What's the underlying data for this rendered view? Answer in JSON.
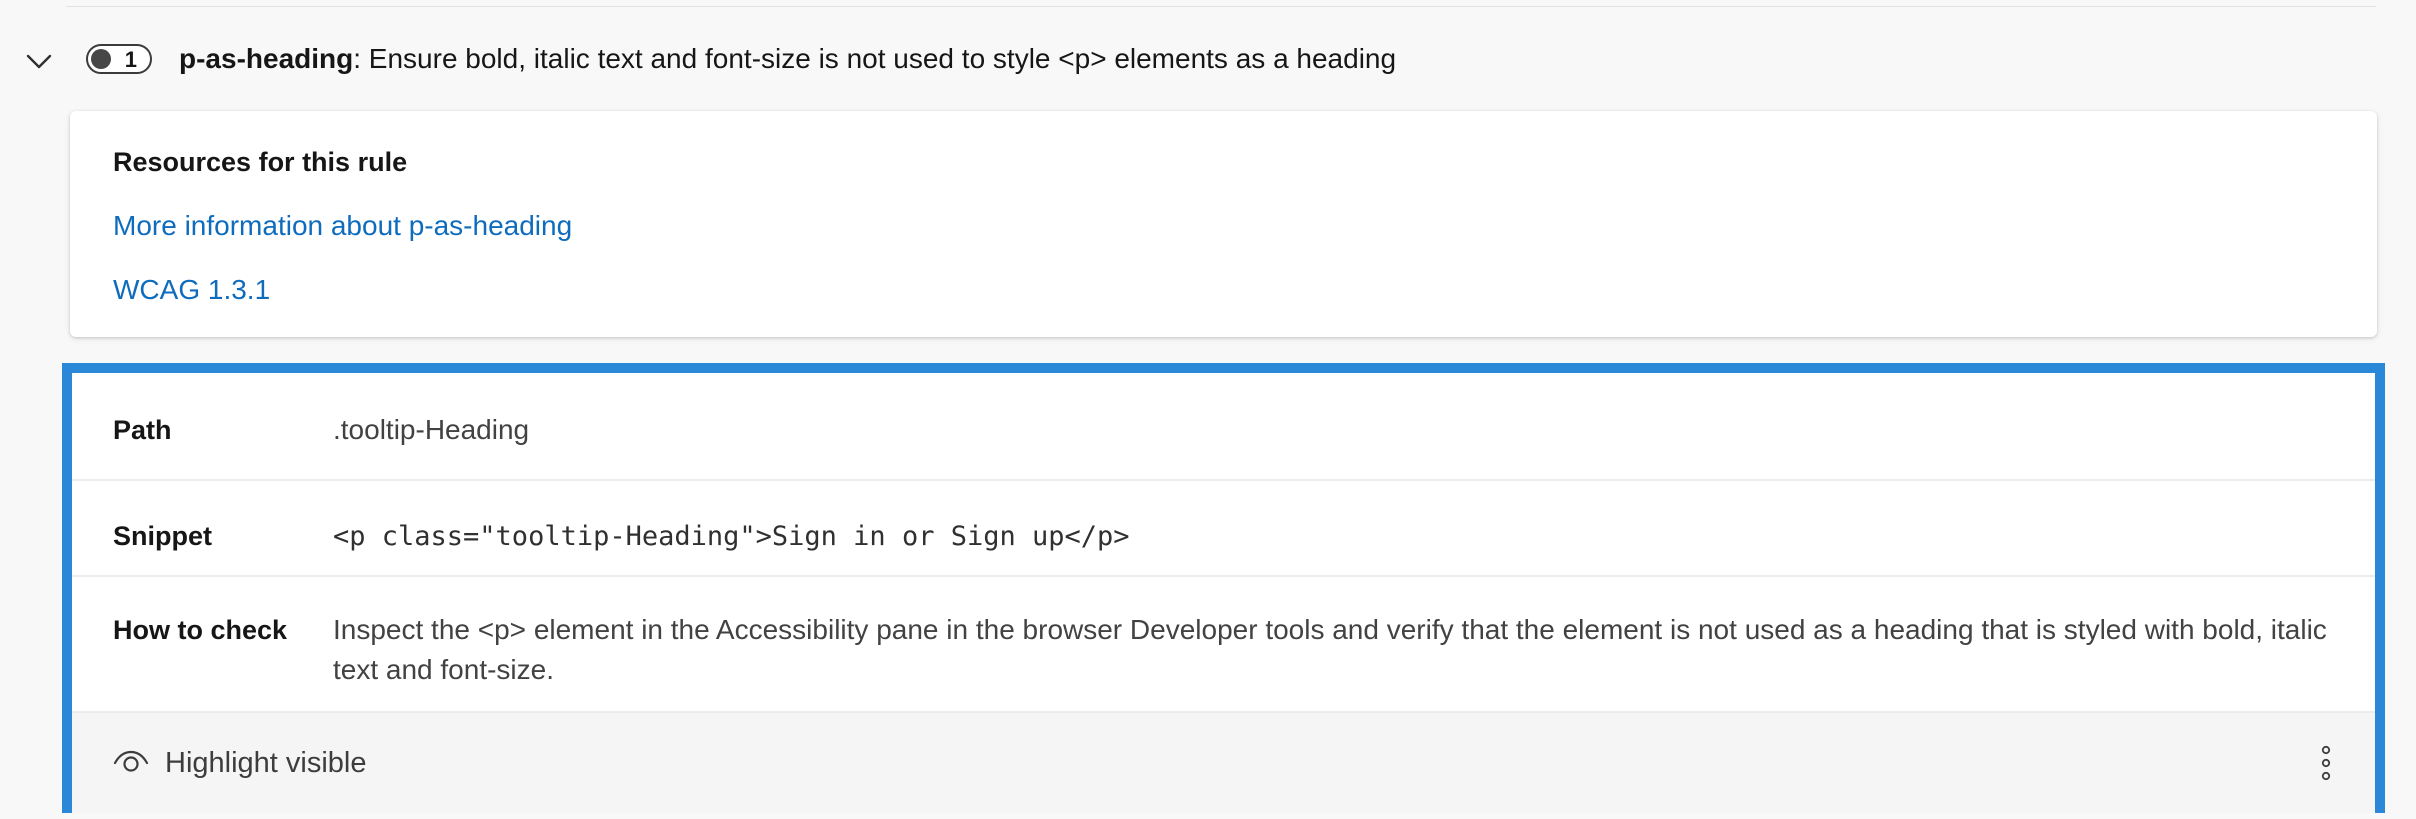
{
  "rule": {
    "count": "1",
    "id": "p-as-heading",
    "description": ": Ensure bold, italic text and font-size is not used to style <p> elements as a heading"
  },
  "resources": {
    "title": "Resources for this rule",
    "links": [
      "More information about p-as-heading",
      "WCAG 1.3.1"
    ]
  },
  "instance": {
    "rows": [
      {
        "label": "Path",
        "value": ".tooltip-Heading"
      },
      {
        "label": "Snippet",
        "value": "<p class=\"tooltip-Heading\">Sign in or Sign up</p>"
      },
      {
        "label": "How to check",
        "value": "Inspect the <p> element in the Accessibility pane in the browser Developer tools and verify that the element is not used as a heading that is styled with bold, italic text and font-size."
      }
    ],
    "highlight_label": "Highlight visible"
  },
  "icons": {
    "expand": "chevron-down-icon",
    "highlight": "eye-icon",
    "more": "more-vertical-icon"
  },
  "colors": {
    "link": "#0f6cbd",
    "focus_border": "#2b88d8",
    "page_background": "#f8f8f8"
  }
}
